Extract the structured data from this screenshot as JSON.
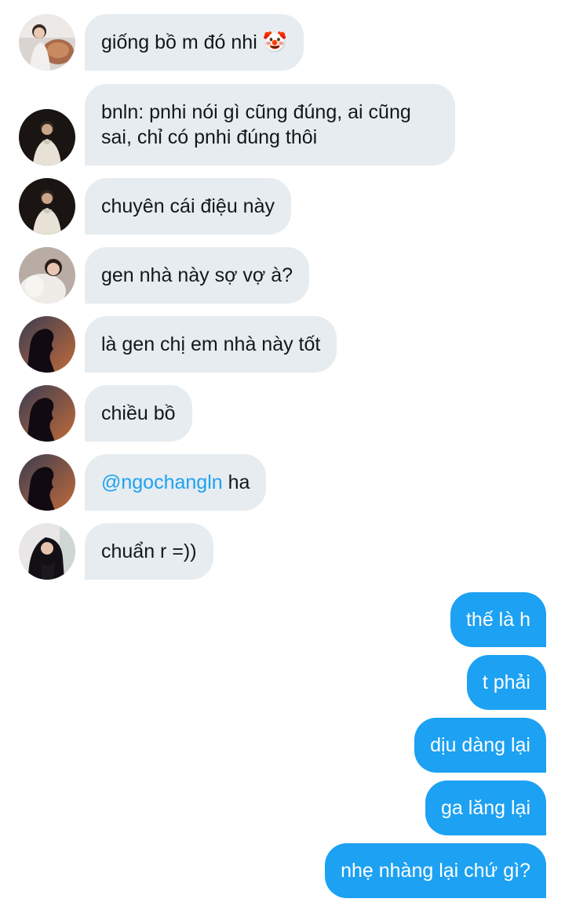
{
  "messages_in": [
    {
      "text": "giống bồ m đó nhi",
      "emoji": "🤡"
    },
    {
      "text": "bnln: pnhi nói gì cũng đúng, ai cũng sai, chỉ có pnhi đúng thôi"
    },
    {
      "text": "chuyên cái điệu này"
    },
    {
      "text": "gen nhà này sợ vợ à?"
    },
    {
      "text": "là gen chị em nhà này tốt"
    },
    {
      "text": "chiều bồ"
    },
    {
      "mention": "@ngochangln",
      "text": " ha"
    },
    {
      "text": "chuẩn r =))"
    }
  ],
  "messages_out": [
    {
      "text": "thế là h"
    },
    {
      "text": "t phải"
    },
    {
      "text": "dịu dàng lại"
    },
    {
      "text": "ga lăng lại"
    },
    {
      "text": "nhẹ nhàng lại chứ gì?"
    }
  ],
  "colors": {
    "incoming_bubble": "#e6ecf0",
    "outgoing_bubble": "#1da1f2",
    "mention": "#1da1f2"
  }
}
